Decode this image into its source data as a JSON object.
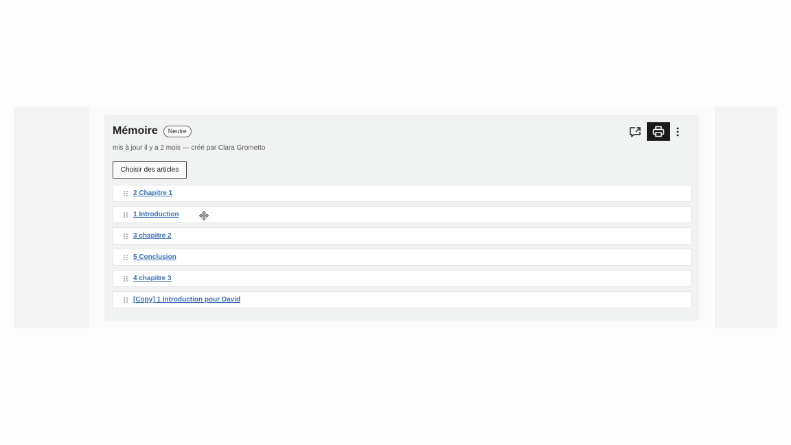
{
  "card": {
    "title": "Mémoire",
    "badge": "Neutre",
    "meta": "mis à jour il y a 2 mois — créé par Clara Grometto",
    "choose_button": "Choisir des articles"
  },
  "articles": [
    {
      "label": "2 Chapitre 1"
    },
    {
      "label": "1 Introduction"
    },
    {
      "label": "3 chapitre 2"
    },
    {
      "label": "5 Conclusion"
    },
    {
      "label": "4 chapitre 3"
    },
    {
      "label": "[Copy] 1 Introduction pour David"
    }
  ],
  "icons": {
    "share": "share-icon",
    "print": "print-icon",
    "more": "more-vertical-icon",
    "drag": "drag-handle-icon",
    "cursor": "move-cursor-icon"
  },
  "colors": {
    "link": "#3a6fb7",
    "card_bg": "#f1f2f2",
    "print_button_bg": "#1a1a1a"
  }
}
